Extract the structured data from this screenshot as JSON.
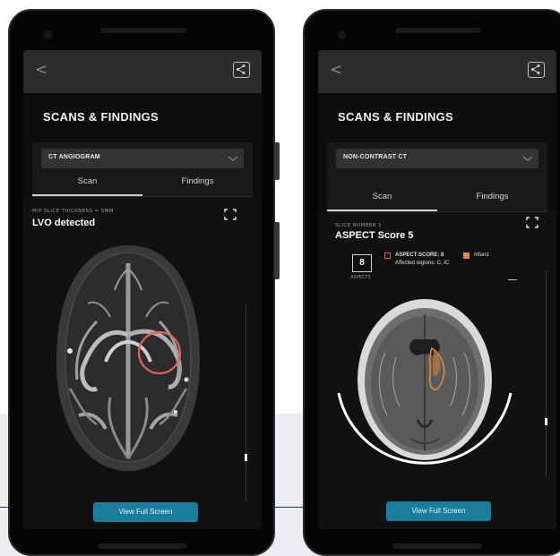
{
  "left_phone": {
    "title": "SCANS & FINDINGS",
    "back_icon": "chevron-left-icon",
    "share_icon": "share-icon",
    "select": {
      "value": "CT ANGIOGRAM",
      "icon": "chevron-down-icon"
    },
    "tabs": [
      {
        "label": "Scan",
        "active": true
      },
      {
        "label": "Findings",
        "active": false
      }
    ],
    "scan": {
      "sublabel": "MIP SLICE THICKNESS = 5MM",
      "headline": "LVO detected",
      "fullscreen_icon": "fullscreen-icon",
      "highlight_color": "#e0635a"
    },
    "cta": "View Full Screen"
  },
  "right_phone": {
    "title": "SCANS & FINDINGS",
    "back_icon": "chevron-left-icon",
    "share_icon": "share-icon",
    "select": {
      "value": "NON-CONTRAST CT",
      "icon": "chevron-down-icon"
    },
    "tabs": [
      {
        "label": "Scan",
        "active": true
      },
      {
        "label": "Findings",
        "active": false
      }
    ],
    "scan": {
      "sublabel": "SLICE NUMBER 1",
      "headline": "ASPECT Score 5",
      "fullscreen_icon": "fullscreen-icon",
      "aspect_value": "8",
      "aspect_caption": "ASPECTS",
      "aspect_score_label": "ASPECT SCORE: 8",
      "affected_regions": "Affected regions: C, IC",
      "infarct_label": "Infarct",
      "infarct_color": "#e08a3c",
      "aspect_square_color": "#d8703a"
    },
    "cta": "View Full Screen"
  },
  "colors": {
    "accent": "#1a7d9b",
    "screen_bg": "#0d0d0d",
    "topbar_bg": "#2b2b2b"
  }
}
